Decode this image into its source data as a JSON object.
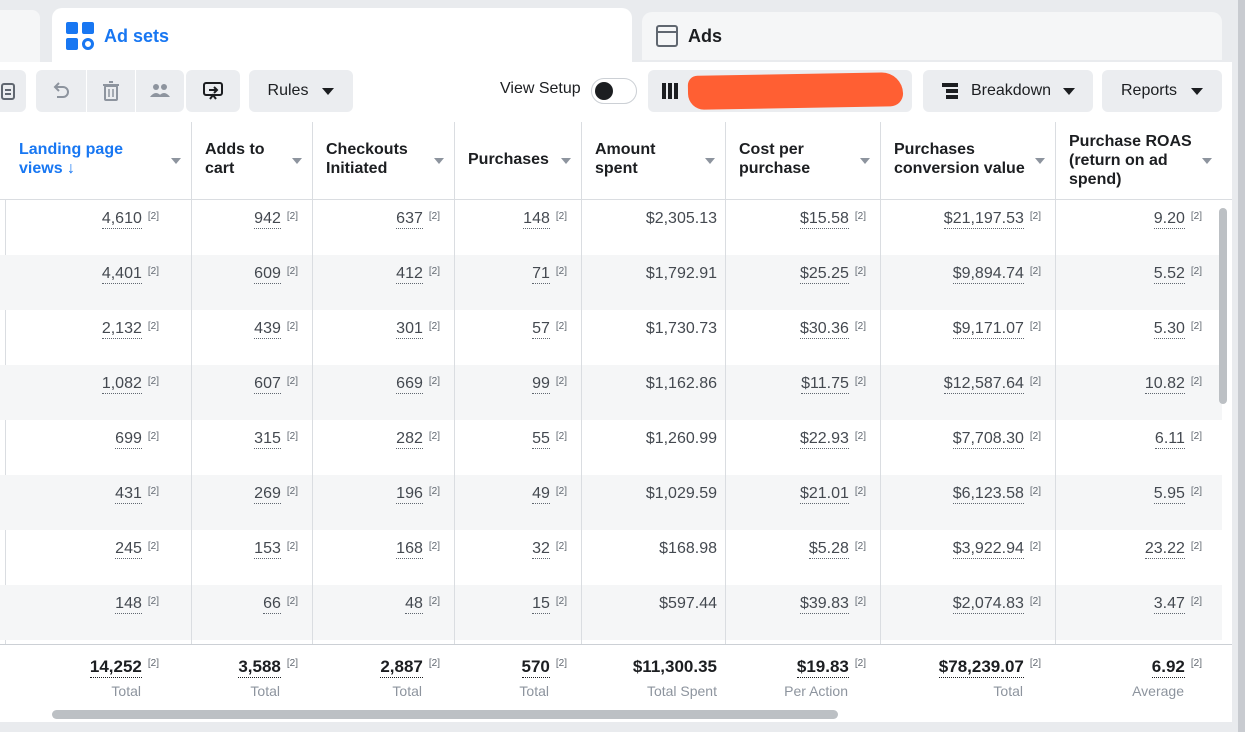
{
  "tabs": {
    "adsets_label": "Ad sets",
    "ads_label": "Ads"
  },
  "toolbar": {
    "rules_label": "Rules",
    "view_setup_label": "View Setup",
    "breakdown_label": "Breakdown",
    "reports_label": "Reports",
    "view_setup_on": false
  },
  "table": {
    "headers": [
      {
        "label": "Landing page views ↓",
        "sorted": true
      },
      {
        "label": "Adds to cart"
      },
      {
        "label": "Checkouts Initiated"
      },
      {
        "label": "Purchases"
      },
      {
        "label": "Amount spent"
      },
      {
        "label": "Cost per purchase"
      },
      {
        "label": "Purchases conversion value"
      },
      {
        "label": "Purchase ROAS (return on ad spend)"
      }
    ],
    "note_marker": "[2]",
    "rows": [
      [
        "4,610",
        "942",
        "637",
        "148",
        "$2,305.13",
        "$15.58",
        "$21,197.53",
        "9.20"
      ],
      [
        "4,401",
        "609",
        "412",
        "71",
        "$1,792.91",
        "$25.25",
        "$9,894.74",
        "5.52"
      ],
      [
        "2,132",
        "439",
        "301",
        "57",
        "$1,730.73",
        "$30.36",
        "$9,171.07",
        "5.30"
      ],
      [
        "1,082",
        "607",
        "669",
        "99",
        "$1,162.86",
        "$11.75",
        "$12,587.64",
        "10.82"
      ],
      [
        "699",
        "315",
        "282",
        "55",
        "$1,260.99",
        "$22.93",
        "$7,708.30",
        "6.11"
      ],
      [
        "431",
        "269",
        "196",
        "49",
        "$1,029.59",
        "$21.01",
        "$6,123.58",
        "5.95"
      ],
      [
        "245",
        "153",
        "168",
        "32",
        "$168.98",
        "$5.28",
        "$3,922.94",
        "23.22"
      ],
      [
        "148",
        "66",
        "48",
        "15",
        "$597.44",
        "$39.83",
        "$2,074.83",
        "3.47"
      ]
    ],
    "totals": [
      {
        "value": "14,252",
        "label": "Total"
      },
      {
        "value": "3,588",
        "label": "Total"
      },
      {
        "value": "2,887",
        "label": "Total"
      },
      {
        "value": "570",
        "label": "Total"
      },
      {
        "value": "$11,300.35",
        "label": "Total Spent"
      },
      {
        "value": "$19.83",
        "label": "Per Action"
      },
      {
        "value": "$78,239.07",
        "label": "Total"
      },
      {
        "value": "6.92",
        "label": "Average"
      }
    ]
  }
}
